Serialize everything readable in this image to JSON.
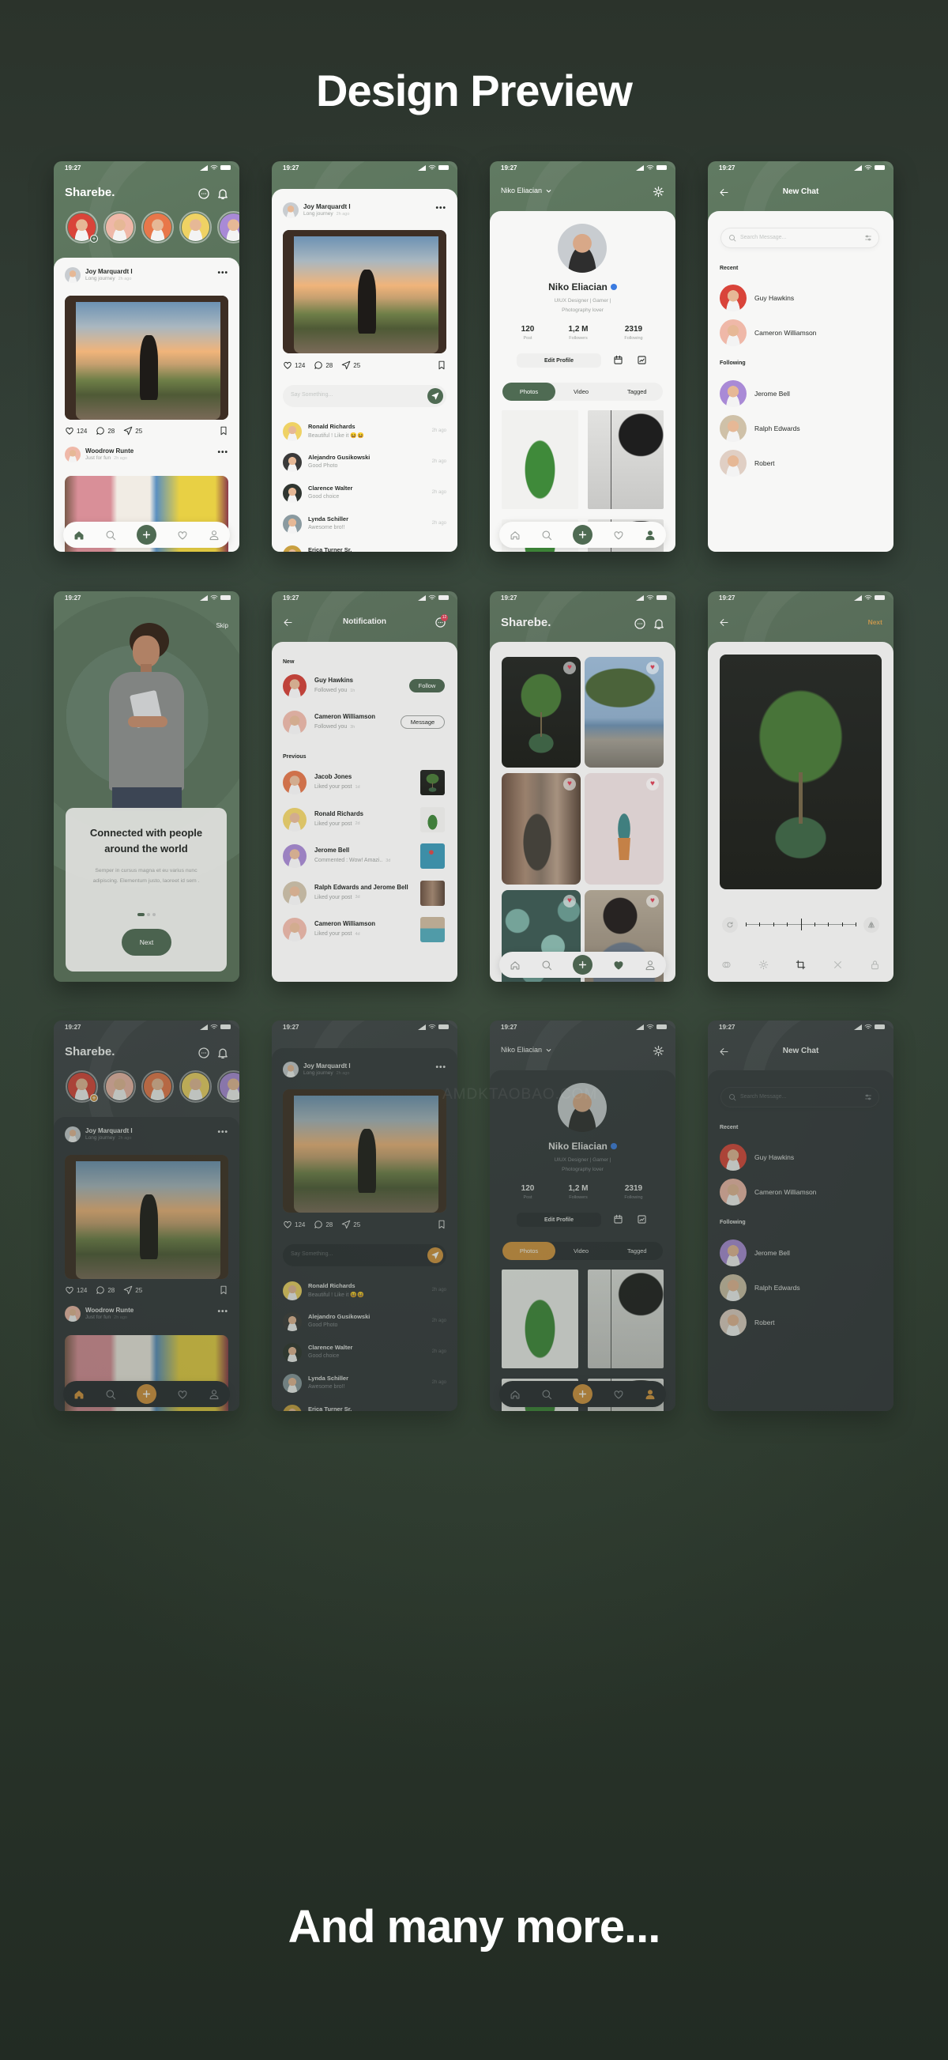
{
  "header": {
    "title": "Design Preview"
  },
  "footer": {
    "title": "And many more..."
  },
  "watermark": "AMDKTAOBAO.COM",
  "status_time": "19:27",
  "colors": {
    "brand_green": "#4f6b53",
    "dark_accent": "#d4943f",
    "like_red": "#e8435a",
    "verified_blue": "#3b7be0",
    "next_orange": "#d8a04a"
  },
  "screens": {
    "home": {
      "app_title": "Sharebe.",
      "stories": [
        {
          "avatar_color": "#d9443a"
        },
        {
          "avatar_color": "#efb8a8"
        },
        {
          "avatar_color": "#e8774a"
        },
        {
          "avatar_color": "#efd264"
        },
        {
          "avatar_color": "#a98ad6"
        }
      ],
      "posts": [
        {
          "name": "Joy Marquardt I",
          "caption": "Long journey",
          "time": "2h ago",
          "likes": "124",
          "comments": "28",
          "shares": "25",
          "avatar_color": "#c8ccd0"
        },
        {
          "name": "Woodrow Runte",
          "caption": "Just for fun",
          "time": "2h ago",
          "avatar_color": "#efb8a8"
        }
      ]
    },
    "post": {
      "author": "Joy Marquardt I",
      "caption": "Long journey",
      "time": "2h ago",
      "avatar_color": "#c8ccd0",
      "likes": "124",
      "comments": "28",
      "shares": "25",
      "input_placeholder": "Say Something...",
      "comments_list": [
        {
          "name": "Ronald Richards",
          "text": "Beautiful ! Like it 😆😆",
          "time": "2h ago",
          "avatar_color": "#efd264"
        },
        {
          "name": "Alejandro Gusikowski",
          "text": "Good Photo",
          "time": "2h ago",
          "avatar_color": "#3a3a3a"
        },
        {
          "name": "Clarence Walter",
          "text": "Good choice",
          "time": "2h ago",
          "avatar_color": "#2f3530"
        },
        {
          "name": "Lynda Schiller",
          "text": "Awesome bro!!",
          "time": "2h ago",
          "avatar_color": "#8a9aa0"
        },
        {
          "name": "Erica Turner Sr.",
          "text": "",
          "time": "",
          "avatar_color": "#c9a040"
        }
      ]
    },
    "profile": {
      "username": "Niko Eliacian",
      "name": "Niko Eliacian",
      "bio_line1": "UIUX Designer | Gamer |",
      "bio_line2": "Photography lover",
      "stats": [
        {
          "value": "120",
          "label": "Post"
        },
        {
          "value": "1,2 M",
          "label": "Followers"
        },
        {
          "value": "2319",
          "label": "Following"
        }
      ],
      "edit_label": "Edit Profile",
      "tabs": [
        "Photos",
        "Video",
        "Tagged"
      ],
      "active_tab": "Photos"
    },
    "chat": {
      "title": "New Chat",
      "search_placeholder": "Search Message...",
      "recent_label": "Recent",
      "recent": [
        {
          "name": "Guy Hawkins",
          "avatar_color": "#d9443a"
        },
        {
          "name": "Cameron Williamson",
          "avatar_color": "#efb8a8"
        }
      ],
      "following_label": "Following",
      "following": [
        {
          "name": "Jerome Bell",
          "avatar_color": "#a98ad6"
        },
        {
          "name": "Ralph Edwards",
          "avatar_color": "#cfc1a8"
        },
        {
          "name": "Robert",
          "avatar_color": "#e0cfc4"
        }
      ]
    },
    "onboarding": {
      "skip": "Skip",
      "heading": "Connected with people around the world",
      "body": "Semper in cursus magna et eu varius nunc adipiscing. Elementum justo, laoreet id sem .",
      "next": "Next",
      "page": 1,
      "pages": 3
    },
    "notification": {
      "title": "Notification",
      "badge": "12",
      "new_label": "New",
      "new": [
        {
          "name": "Guy Hawkins",
          "text": "Followed you",
          "time": "1h",
          "action": "Follow",
          "avatar_color": "#d9443a"
        },
        {
          "name": "Cameron Williamson",
          "text": "Followed you",
          "time": "3h",
          "action": "Message",
          "avatar_color": "#efb8a8"
        }
      ],
      "previous_label": "Previous",
      "previous": [
        {
          "name": "Jacob Jones",
          "text": "Liked your post",
          "time": "1d",
          "avatar_color": "#e8774a"
        },
        {
          "name": "Ronald Richards",
          "text": "Liked your post",
          "time": "2d",
          "avatar_color": "#efd264"
        },
        {
          "name": "Jerome Bell",
          "text": "Commented : Wow! Amazi..",
          "time": "3d",
          "avatar_color": "#a98ad6"
        },
        {
          "name": "Ralph Edwards and Jerome Bell",
          "text": "Liked your post",
          "time": "3d",
          "avatar_color": "#cfc1a8"
        },
        {
          "name": "Cameron Williamson",
          "text": "Liked your post",
          "time": "4d",
          "avatar_color": "#efb8a8"
        }
      ]
    },
    "explore": {
      "app_title": "Sharebe.",
      "liked_count": 6
    },
    "edit": {
      "next": "Next"
    }
  },
  "rows": [
    {
      "theme": "light",
      "screens": [
        "home",
        "post",
        "profile",
        "chat"
      ]
    },
    {
      "theme": "light",
      "screens": [
        "onboarding",
        "notification",
        "explore",
        "edit"
      ]
    },
    {
      "theme": "dark",
      "screens": [
        "home",
        "post",
        "profile",
        "chat"
      ]
    },
    {
      "theme": "dark",
      "screens": [
        "onboarding",
        "notification",
        "explore",
        "edit"
      ]
    }
  ]
}
